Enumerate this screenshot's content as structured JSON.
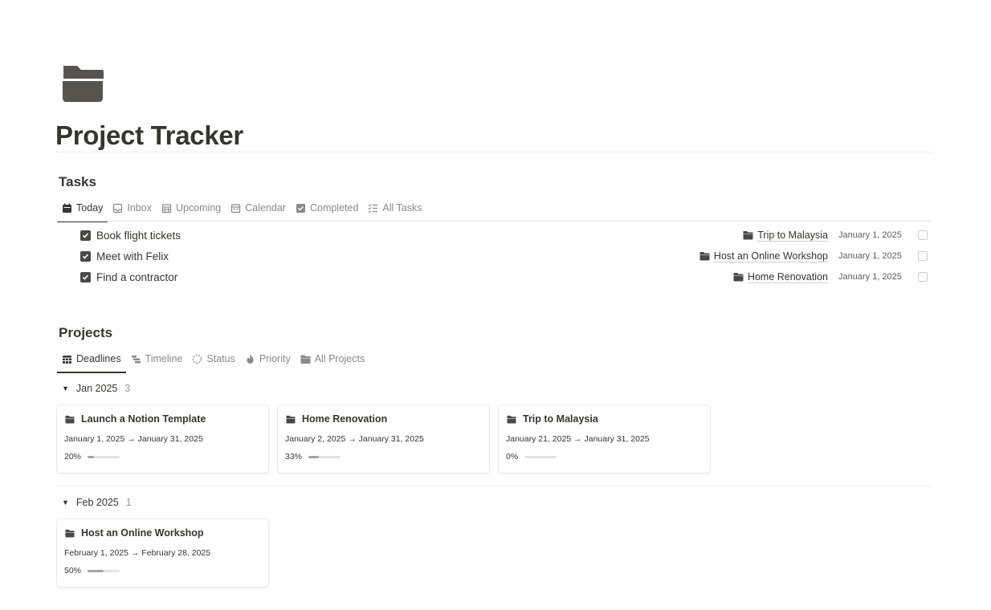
{
  "page": {
    "title": "Project Tracker",
    "icon": "folder-icon"
  },
  "tasks": {
    "heading": "Tasks",
    "tabs": [
      {
        "label": "Today",
        "icon": "calendar-day-icon",
        "active": true
      },
      {
        "label": "Inbox",
        "icon": "inbox-icon",
        "active": false
      },
      {
        "label": "Upcoming",
        "icon": "calendar-grid-icon",
        "active": false
      },
      {
        "label": "Calendar",
        "icon": "calendar-icon",
        "active": false
      },
      {
        "label": "Completed",
        "icon": "checkbox-icon",
        "active": false
      },
      {
        "label": "All Tasks",
        "icon": "checklist-icon",
        "active": false
      }
    ],
    "rows": [
      {
        "name": "Book flight tickets",
        "project": "Trip to Malaysia",
        "date": "January 1, 2025",
        "done": true
      },
      {
        "name": "Meet with Felix",
        "project": "Host an Online Workshop",
        "date": "January 1, 2025",
        "done": true
      },
      {
        "name": "Find a contractor",
        "project": "Home Renovation",
        "date": "January 1, 2025",
        "done": true
      }
    ]
  },
  "projects": {
    "heading": "Projects",
    "tabs": [
      {
        "label": "Deadlines",
        "icon": "calendar-grid-icon",
        "active": true
      },
      {
        "label": "Timeline",
        "icon": "timeline-icon",
        "active": false
      },
      {
        "label": "Status",
        "icon": "loading-circle-icon",
        "active": false
      },
      {
        "label": "Priority",
        "icon": "flame-icon",
        "active": false
      },
      {
        "label": "All Projects",
        "icon": "folder-icon",
        "active": false
      }
    ],
    "groups": [
      {
        "label": "Jan 2025",
        "count": "3",
        "cards": [
          {
            "title": "Launch a Notion Template",
            "dates": "January 1, 2025 → January 31, 2025",
            "progress_label": "20%",
            "progress": 0.2
          },
          {
            "title": "Home Renovation",
            "dates": "January 2, 2025 → January 31, 2025",
            "progress_label": "33%",
            "progress": 0.33
          },
          {
            "title": "Trip to Malaysia",
            "dates": "January 21, 2025 → January 31, 2025",
            "progress_label": "0%",
            "progress": 0
          }
        ]
      },
      {
        "label": "Feb 2025",
        "count": "1",
        "cards": [
          {
            "title": "Host an Online Workshop",
            "dates": "February 1, 2025 → February 28, 2025",
            "progress_label": "50%",
            "progress": 0.5
          }
        ]
      }
    ]
  },
  "colors": {
    "text": "#37352f",
    "muted": "#8a8985",
    "checkbox": "#4a4945",
    "progress_fill": "#a5a4a0"
  }
}
